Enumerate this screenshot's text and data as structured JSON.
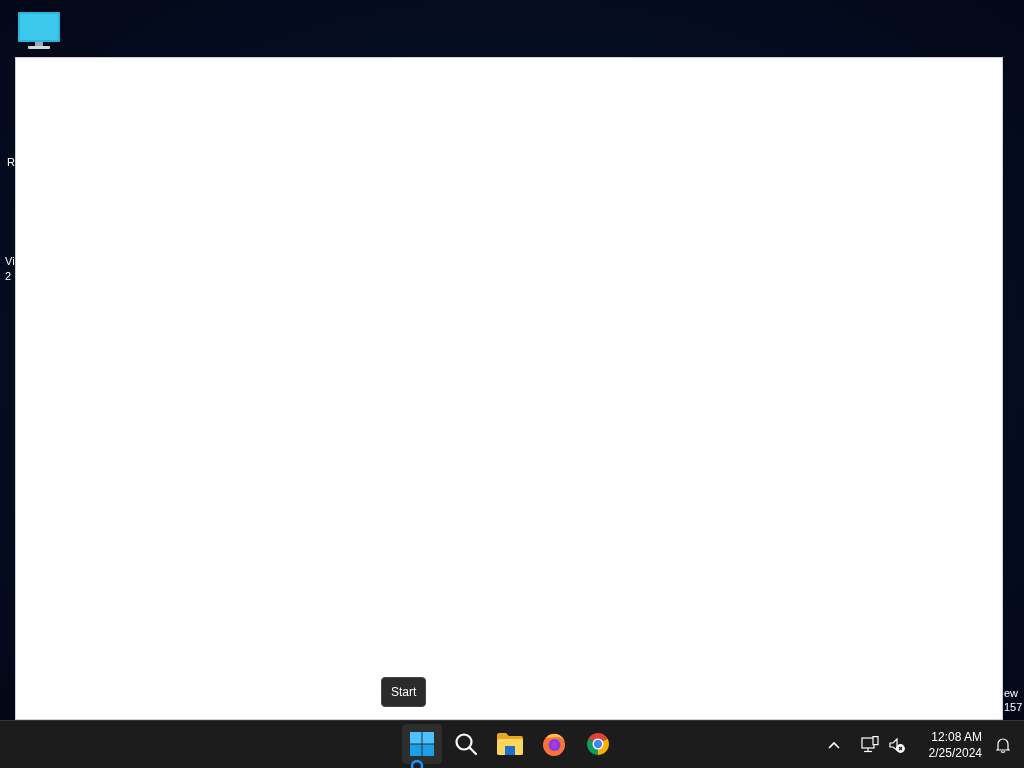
{
  "desktop": {
    "icons": [
      {
        "kind": "computer"
      }
    ],
    "partial_labels": [
      {
        "text": "R"
      },
      {
        "text": "Vi"
      },
      {
        "text": "2"
      },
      {
        "text": "ew"
      },
      {
        "text": "157"
      }
    ]
  },
  "window": {
    "kind": "blank"
  },
  "tooltip": {
    "text": "Start"
  },
  "taskbar": {
    "apps": [
      {
        "kind": "start",
        "selected": true
      },
      {
        "kind": "search",
        "selected": false
      },
      {
        "kind": "files",
        "selected": false
      },
      {
        "kind": "firefox",
        "selected": false
      },
      {
        "kind": "chrome",
        "selected": false
      }
    ],
    "tray": {
      "volume_muted": true,
      "time": "12:08 AM",
      "date": "2/25/2024"
    }
  }
}
